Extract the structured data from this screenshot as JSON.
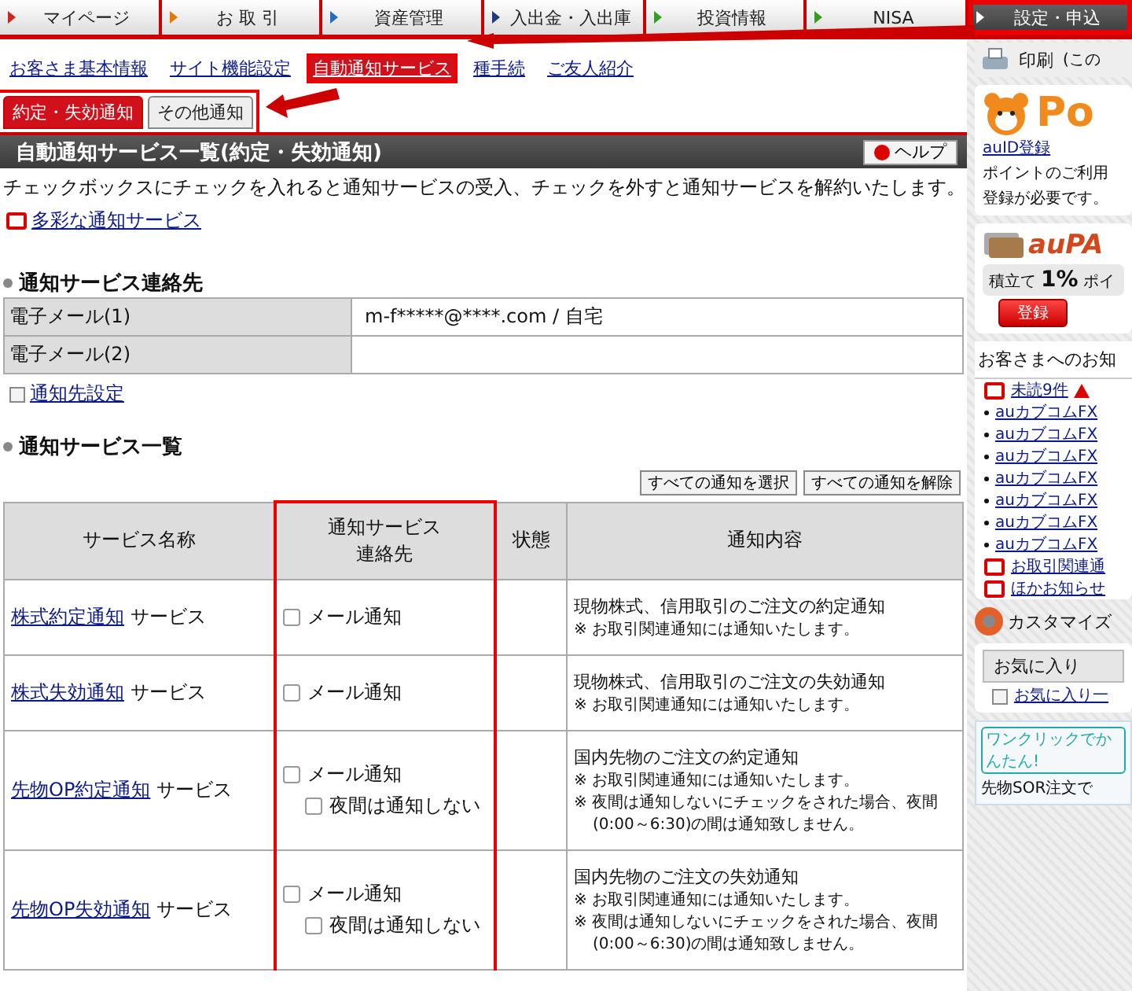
{
  "top_nav": [
    {
      "label": "マイページ",
      "selected": false,
      "highlighted": false,
      "color": "#c8281e"
    },
    {
      "label": "お 取 引",
      "selected": false,
      "highlighted": false,
      "color": "#e07a10"
    },
    {
      "label": "資産管理",
      "selected": false,
      "highlighted": false,
      "color": "#2a6cb8"
    },
    {
      "label": "入出金・入出庫",
      "selected": false,
      "highlighted": false,
      "color": "#1e3a78"
    },
    {
      "label": "投資情報",
      "selected": false,
      "highlighted": false,
      "color": "#3a9a2a"
    },
    {
      "label": "NISA",
      "selected": false,
      "highlighted": false,
      "color": "#3a9a2a"
    },
    {
      "label": "設定・申込",
      "selected": true,
      "highlighted": true,
      "color": "#ffffff"
    }
  ],
  "sub_nav": [
    {
      "label": "お客さま基本情報",
      "selected": false,
      "highlighted": false
    },
    {
      "label": "サイト機能設定",
      "selected": false,
      "highlighted": false
    },
    {
      "label": "自動通知サービス",
      "selected": true,
      "highlighted": true
    },
    {
      "label": "種手続",
      "selected": false,
      "highlighted": false
    },
    {
      "label": "ご友人紹介",
      "selected": false,
      "highlighted": false
    }
  ],
  "print_bar": {
    "label": "印刷",
    "note": "(この"
  },
  "tabs_highlighted": true,
  "tabs": [
    {
      "label": "約定・失効通知",
      "selected": true
    },
    {
      "label": "その他通知",
      "selected": false
    }
  ],
  "page_title": "自動通知サービス一覧(約定・失効通知)",
  "help_button": "ヘルプ",
  "intro": "チェックボックスにチェックを入れると通知サービスの受入、チェックを外すと通知サービスを解約いたします。",
  "intro_link": "多彩な通知サービス",
  "contact_section": {
    "heading": "通知サービス連絡先",
    "rows": [
      {
        "label": "電子メール(1)",
        "value": "m-f*****@****.com / 自宅"
      },
      {
        "label": "電子メール(2)"
      }
    ],
    "link": "通知先設定"
  },
  "list_section": {
    "heading": "通知サービス一覧",
    "buttons": [
      "すべての通知を選択",
      "すべての通知を解除"
    ],
    "columns": [
      {
        "label": "サービス名称",
        "highlighted": false
      },
      {
        "label": "通知サービス連絡先",
        "highlighted": true
      },
      {
        "label": "状態",
        "highlighted": false
      },
      {
        "label": "通知内容",
        "highlighted": false
      }
    ],
    "rows": [
      {
        "service_link": "株式約定通知",
        "service_suffix": "サービス",
        "options": [
          {
            "kind": "main",
            "label": "メール通知",
            "checked": false
          }
        ],
        "content_title": "現物株式、信用取引のご注文の約定通知",
        "notes": [
          "※ お取引関連通知には通知いたします。"
        ]
      },
      {
        "service_link": "株式失効通知",
        "service_suffix": "サービス",
        "options": [
          {
            "kind": "main",
            "label": "メール通知",
            "checked": false
          }
        ],
        "content_title": "現物株式、信用取引のご注文の失効通知",
        "notes": [
          "※ お取引関連通知には通知いたします。"
        ]
      },
      {
        "service_link": "先物OP約定通知",
        "service_suffix": "サービス",
        "options": [
          {
            "kind": "main",
            "label": "メール通知",
            "checked": false
          },
          {
            "kind": "sub",
            "label": "夜間は通知しない",
            "checked": false
          }
        ],
        "content_title": "国内先物のご注文の約定通知",
        "notes": [
          "※ お取引関連通知には通知いたします。",
          "※ 夜間は通知しないにチェックをされた場合、夜間(0:00～6:30)の間は通知致しません。"
        ]
      },
      {
        "service_link": "先物OP失効通知",
        "service_suffix": "サービス",
        "options": [
          {
            "kind": "main",
            "label": "メール通知",
            "checked": false
          },
          {
            "kind": "sub",
            "label": "夜間は通知しない",
            "checked": false
          }
        ],
        "content_title": "国内先物のご注文の失効通知",
        "notes": [
          "※ お取引関連通知には通知いたします。",
          "※ 夜間は通知しないにチェックをされた場合、夜間(0:00～6:30)の間は通知致しません。"
        ]
      }
    ]
  },
  "sidebar": {
    "point_card": {
      "brand": "Po",
      "link": "auID登録",
      "lines": [
        "ポイントのご利用",
        "登録が必要です。"
      ]
    },
    "pay_card": {
      "brand": "auPA",
      "rate_prefix": "積立て",
      "rate": "1%",
      "rate_suffix": "ポイ",
      "button": "登録"
    },
    "notices": {
      "heading": "お客さまへのお知",
      "unread": "未読9件",
      "items": [
        "auカブコムFX",
        "auカブコムFX",
        "auカブコムFX",
        "auカブコムFX",
        "auカブコムFX",
        "auカブコムFX",
        "auカブコムFX"
      ],
      "links": [
        "お取引関連通",
        "ほかお知らせ"
      ]
    },
    "customize": {
      "heading": "カスタマイズ",
      "tab": "お気に入り",
      "link": "お気に入り一"
    },
    "banner": {
      "badge": "ワンクリックでかんたん!",
      "headline": "先物SOR注文で"
    }
  }
}
